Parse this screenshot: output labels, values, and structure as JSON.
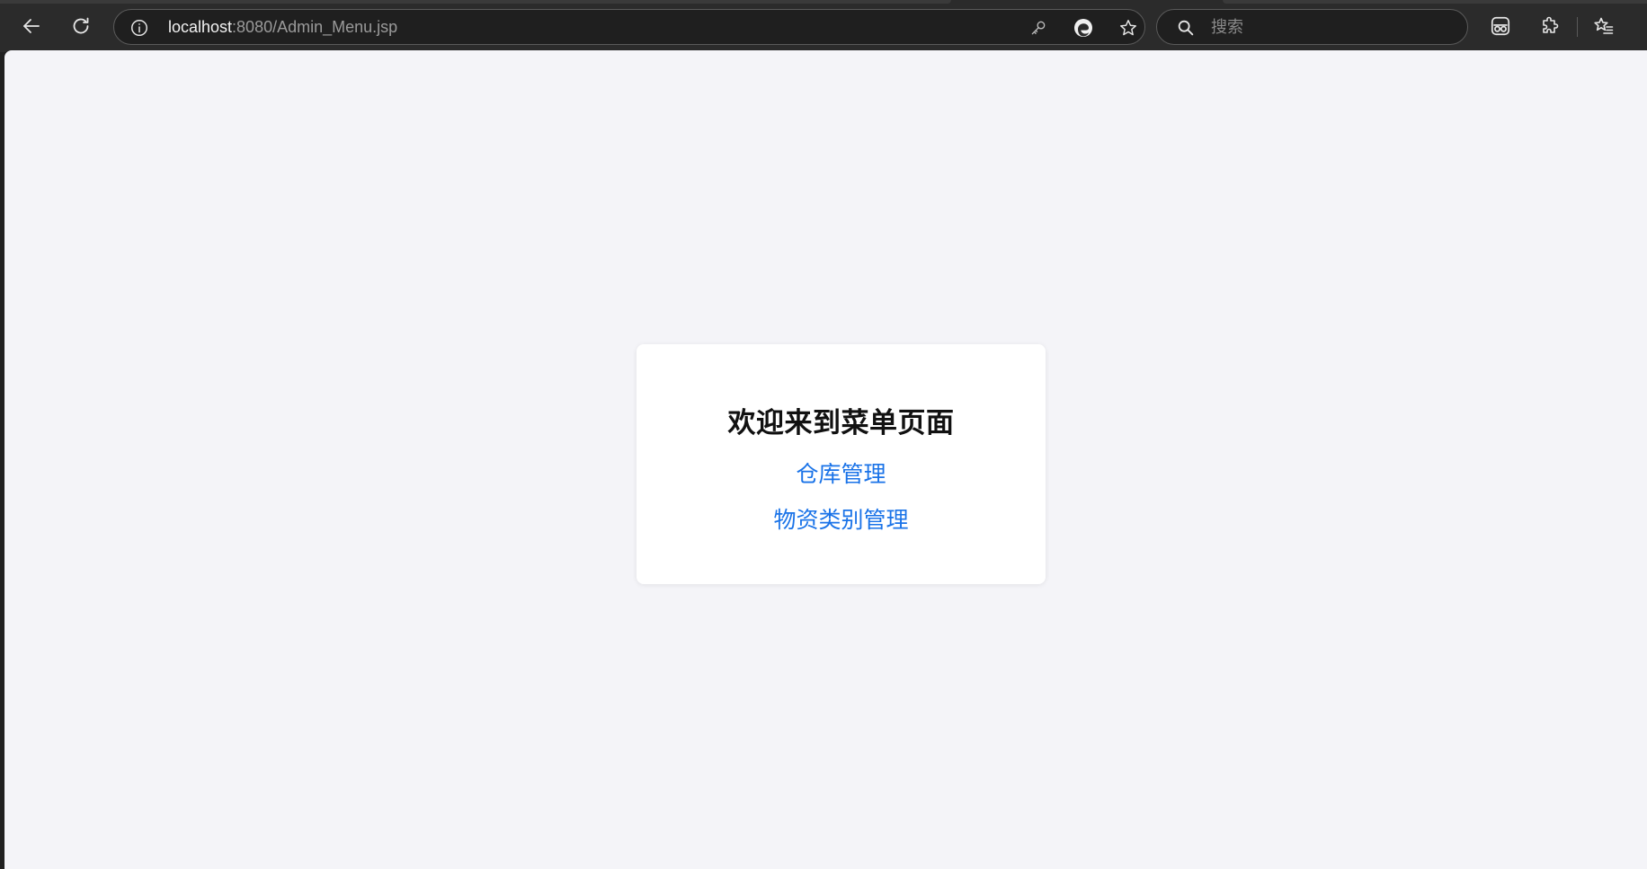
{
  "browser": {
    "address": {
      "host": "localhost",
      "rest": ":8080/Admin_Menu.jsp"
    },
    "search": {
      "placeholder": "搜索"
    },
    "icons": {
      "back": "back-arrow-icon",
      "reload": "reload-icon",
      "site_info": "info-icon",
      "password": "key-icon",
      "edge": "edge-logo-icon",
      "favorite": "star-icon",
      "search": "search-icon",
      "extension_1": "incognito-glasses-icon",
      "extensions": "puzzle-piece-icon",
      "favorites": "favorites-list-icon"
    }
  },
  "page": {
    "title": "欢迎来到菜单页面",
    "links": [
      {
        "label": "仓库管理"
      },
      {
        "label": "物资类别管理"
      }
    ]
  },
  "colors": {
    "toolbar_bg": "#2b2b2b",
    "page_bg": "#f4f4f8",
    "card_bg": "#ffffff",
    "link": "#1a73e8",
    "title": "#111111"
  }
}
